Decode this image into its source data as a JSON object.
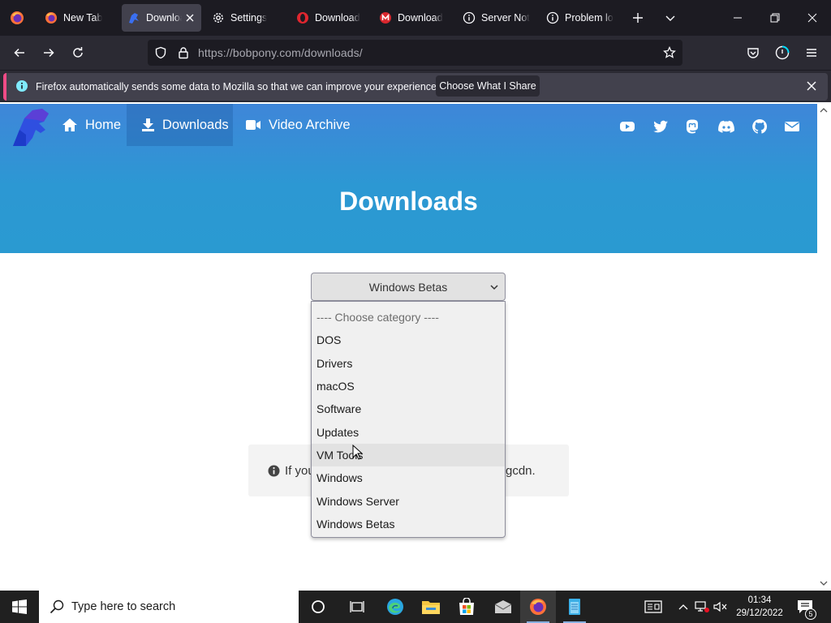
{
  "browser": {
    "tabs": [
      {
        "label": "New Tab",
        "icon": "firefox-icon",
        "active": false
      },
      {
        "label": "Downloads",
        "icon": "bobpony-icon",
        "active": true
      },
      {
        "label": "Settings",
        "icon": "gear-icon",
        "active": false
      },
      {
        "label": "Download",
        "icon": "opera-icon",
        "active": false
      },
      {
        "label": "Download",
        "icon": "mega-icon",
        "active": false
      },
      {
        "label": "Server Not",
        "icon": "info-icon",
        "active": false
      },
      {
        "label": "Problem lo",
        "icon": "info-icon",
        "active": false
      }
    ],
    "url_host": "https://bobpony.com",
    "url_path": "/downloads/",
    "notification": {
      "text": "Firefox automatically sends some data to Mozilla so that we can improve your experience.",
      "button": "Choose What I Share"
    }
  },
  "site": {
    "nav": [
      {
        "label": "Home",
        "icon": "home-icon"
      },
      {
        "label": "Downloads",
        "icon": "download-icon"
      },
      {
        "label": "Video Archive",
        "icon": "video-camera-icon"
      }
    ],
    "social": [
      "youtube-icon",
      "twitter-icon",
      "mastodon-icon",
      "discord-icon",
      "github-icon",
      "email-icon"
    ],
    "title": "Downloads",
    "select": {
      "value": "Windows Betas",
      "options": [
        "---- Choose category ----",
        "DOS",
        "Drivers",
        "macOS",
        "Software",
        "Updates",
        "VM Tools",
        "Windows",
        "Windows Server",
        "Windows Betas"
      ],
      "hovered": "VM Tools"
    },
    "info": {
      "visible_left": "If you",
      "visible_right": "gcdn."
    }
  },
  "taskbar": {
    "search_placeholder": "Type here to search",
    "time": "01:34",
    "date": "29/12/2022",
    "notification_count": "5"
  },
  "colors": {
    "hero_top": "#3f86d9",
    "hero_bottom": "#2a9ad1",
    "notification_accent": "#ef4b86"
  }
}
